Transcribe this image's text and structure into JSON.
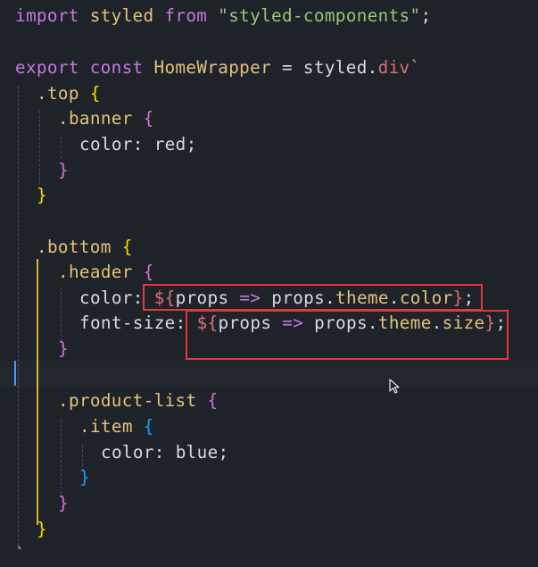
{
  "code": {
    "l1": {
      "kw1": "import",
      "sp1": " ",
      "ident": "styled",
      "sp2": " ",
      "kw2": "from",
      "sp3": " ",
      "str": "\"styled-components\"",
      "semi": ";"
    },
    "l3": {
      "kw1": "export",
      "sp1": " ",
      "kw2": "const",
      "sp2": " ",
      "name": "HomeWrapper",
      "eq": " = ",
      "obj": "styled",
      "dot": ".",
      "tag": "div",
      "tick": "`"
    },
    "l4": {
      "sel": ".top",
      "sp": " ",
      "brace": "{"
    },
    "l5": {
      "sel": ".banner",
      "sp": " ",
      "brace": "{"
    },
    "l6": {
      "prop": "color:",
      "sp": " ",
      "val": "red;"
    },
    "l7": {
      "brace": "}"
    },
    "l8": {
      "brace": "}"
    },
    "l10": {
      "sel": ".bottom",
      "sp": " ",
      "brace": "{"
    },
    "l11": {
      "sel": ".header",
      "sp": " ",
      "brace": "{"
    },
    "l12": {
      "prop": "color:",
      "sp": " ",
      "dollar": "${",
      "a": "props",
      "arrow": " => ",
      "b": "props",
      "d1": ".",
      "c": "theme",
      "d2": ".",
      "e": "color",
      "close": "}",
      "semi": ";"
    },
    "l13": {
      "prop": "font-size:",
      "sp": " ",
      "dollar": "${",
      "a": "props",
      "arrow": " => ",
      "b": "props",
      "d1": ".",
      "c": "theme",
      "d2": ".",
      "e": "size",
      "close": "}",
      "semi": ";"
    },
    "l14": {
      "brace": "}"
    },
    "l16": {
      "sel": ".product-list",
      "sp": " ",
      "brace": "{"
    },
    "l17": {
      "sel": ".item",
      "sp": " ",
      "brace": "{"
    },
    "l18": {
      "prop": "color:",
      "sp": " ",
      "val": "blue;"
    },
    "l19": {
      "brace": "}"
    },
    "l20": {
      "brace": "}"
    },
    "l21": {
      "brace": "}"
    },
    "l22": {
      "tick": "`"
    }
  }
}
